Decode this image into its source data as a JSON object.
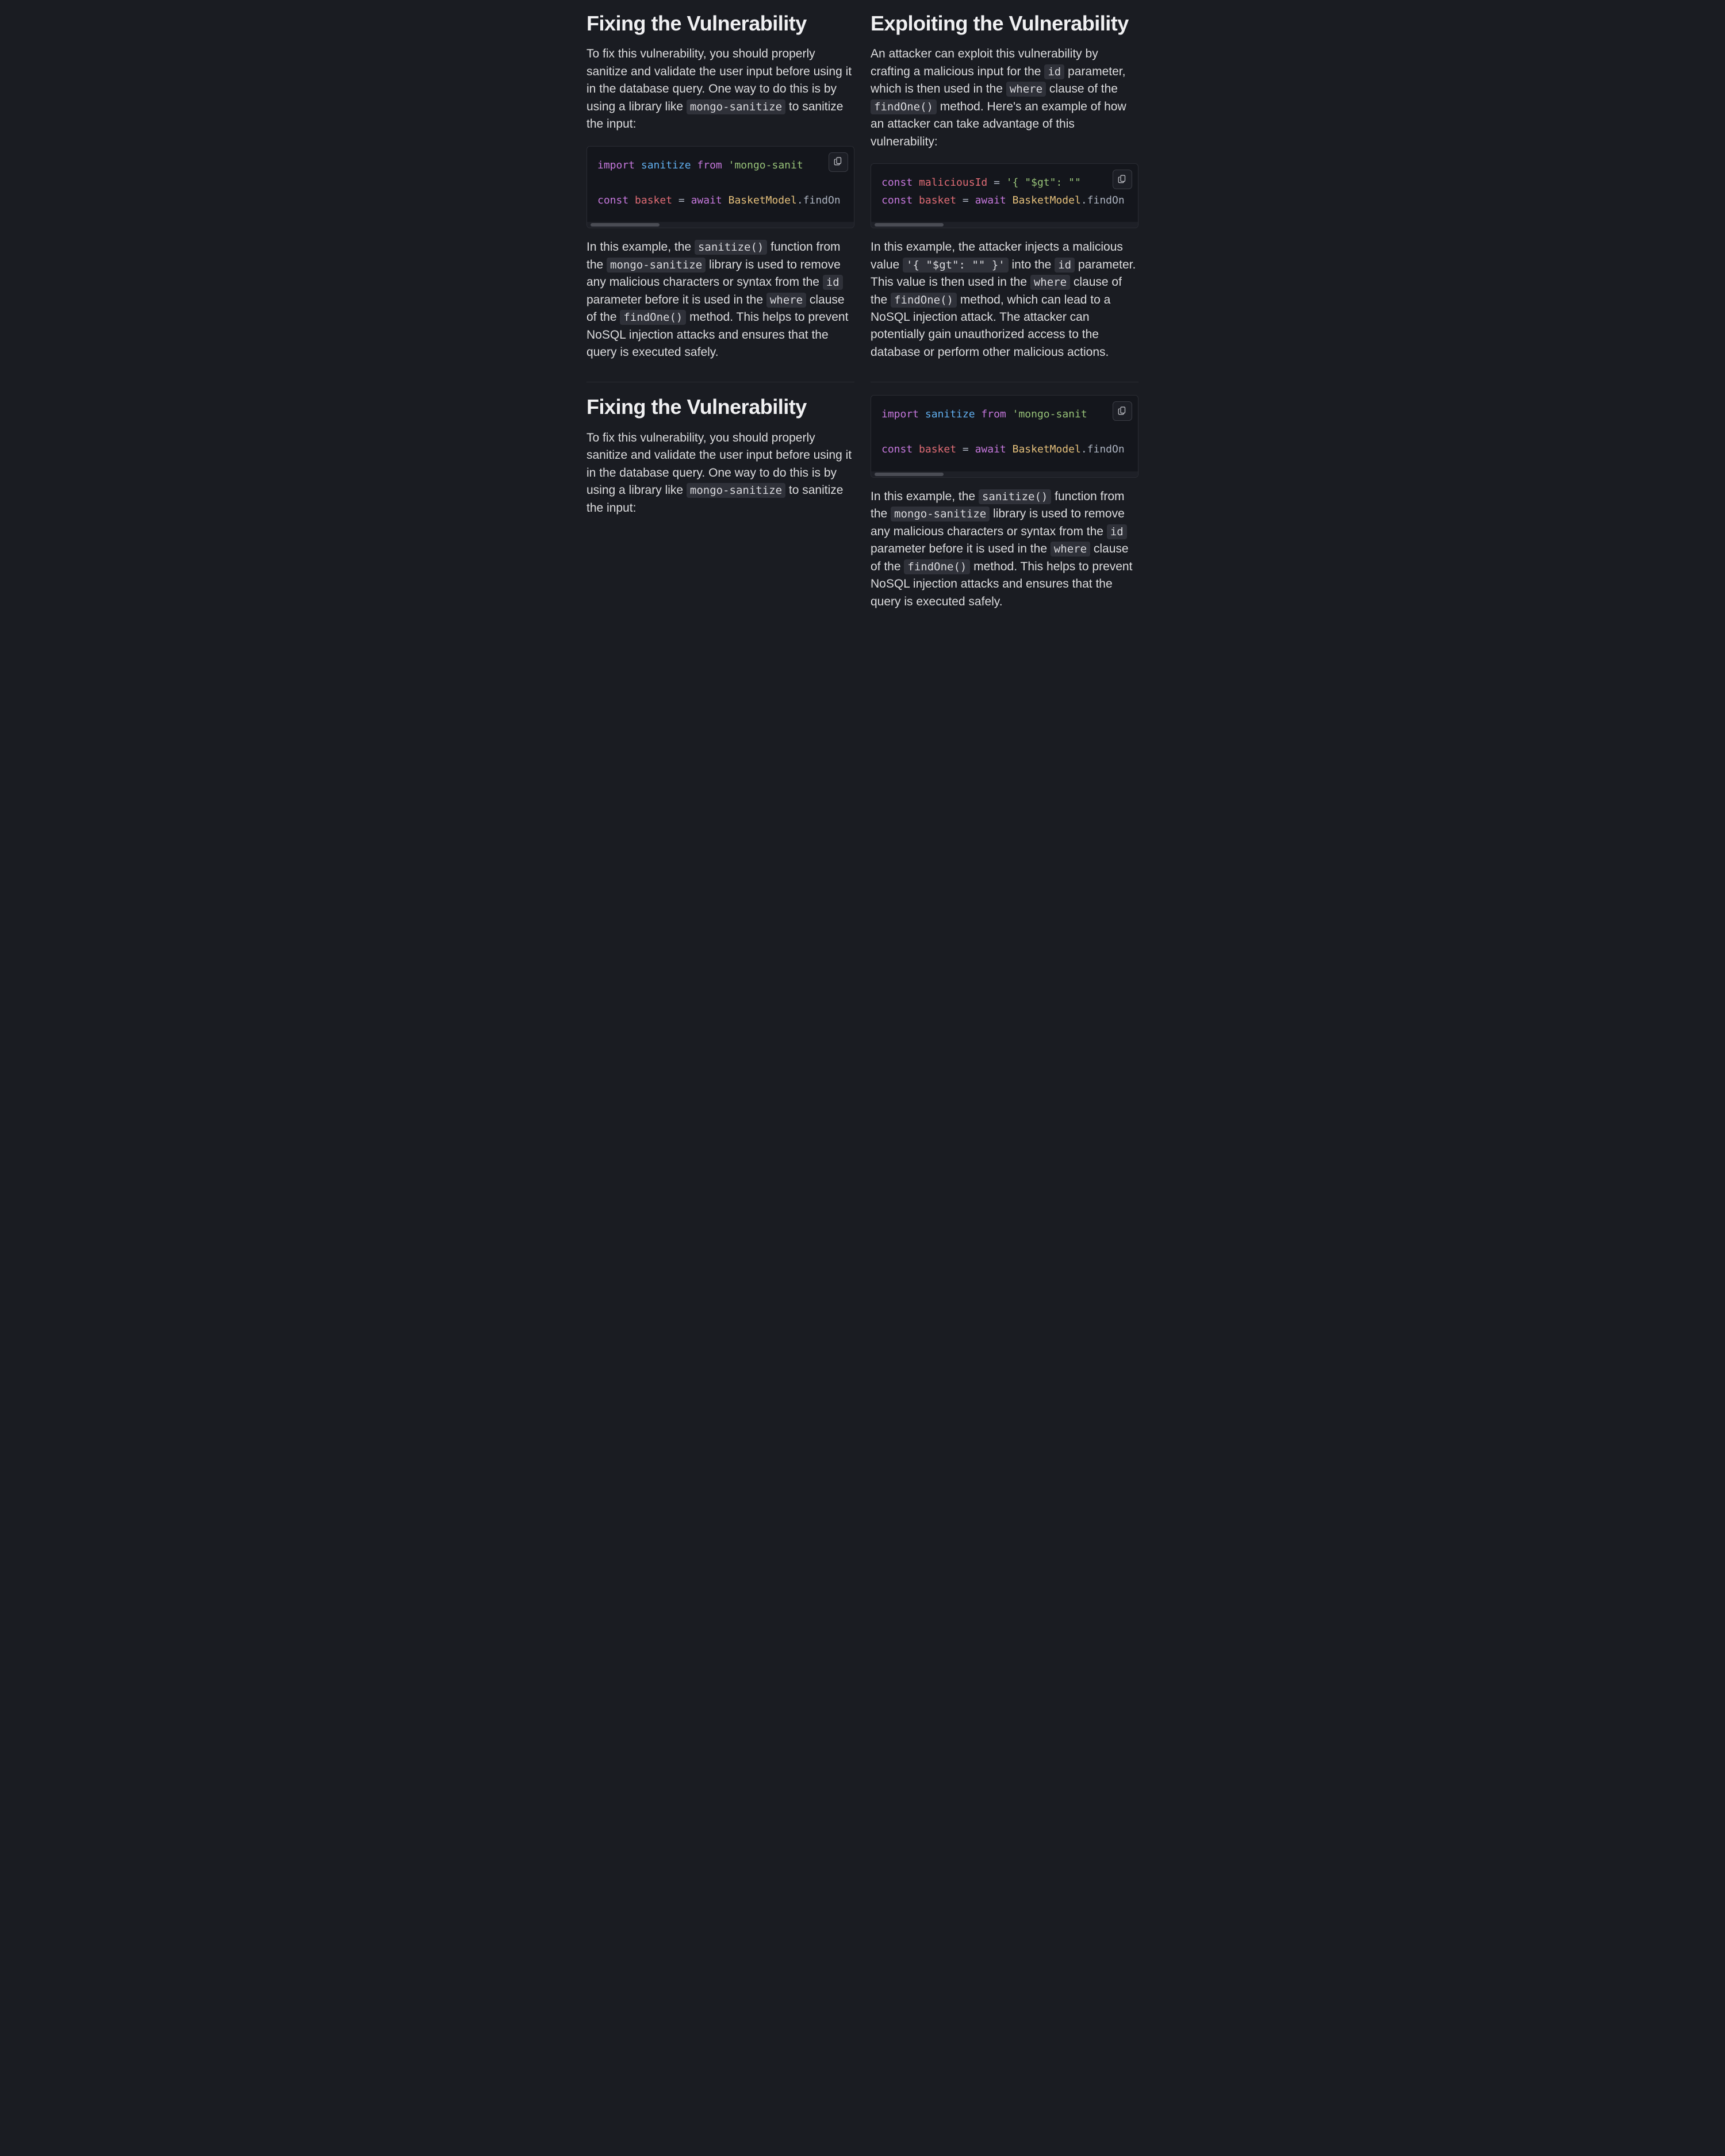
{
  "left": {
    "block1": {
      "heading": "Fixing the Vulnerability",
      "para1_a": "To fix this vulnerability, you should properly sanitize and validate the user input before using it in the database query. One way to do this is by using a library like ",
      "para1_code": "mongo-sanitize",
      "para1_b": " to sanitize the input:",
      "code": {
        "kw_import": "import",
        "fn_sanitize": "sanitize",
        "kw_from": "from",
        "str_pkg_open": "'mongo-sanit",
        "kw_const": "const",
        "id_basket": "basket",
        "eq": " = ",
        "kw_await": "await",
        "type_model": "BasketModel",
        "dot_findone": ".findOn"
      },
      "para2_a": "In this example, the ",
      "para2_c1": "sanitize()",
      "para2_b": " function from the ",
      "para2_c2": "mongo-sanitize",
      "para2_c": " library is used to remove any malicious characters or syntax from the ",
      "para2_c3": "id",
      "para2_d": " parameter before it is used in the ",
      "para2_c4": "where",
      "para2_e": " clause of the ",
      "para2_c5": "findOne()",
      "para2_f": " method. This helps to prevent NoSQL injection attacks and ensures that the query is executed safely."
    },
    "block2": {
      "heading": "Fixing the Vulnerability",
      "para1_a": "To fix this vulnerability, you should properly sanitize and validate the user input before using it in the database query. One way to do this is by using a library like ",
      "para1_code": "mongo-sanitize",
      "para1_b": " to sanitize the input:"
    }
  },
  "right": {
    "block1": {
      "heading": "Exploiting the Vulnerability",
      "para1_a": "An attacker can exploit this vulnerability by crafting a malicious input for the ",
      "para1_c1": "id",
      "para1_b": " parameter, which is then used in the ",
      "para1_c2": "where",
      "para1_c": " clause of the ",
      "para1_c3": "findOne()",
      "para1_d": " method. Here's an example of how an attacker can take advantage of this vulnerability:",
      "code": {
        "kw_const1": "const",
        "id_mal": "maliciousId",
        "eq": " = ",
        "str_mal": "'{ \"$gt\": \"\"",
        "kw_const2": "const",
        "id_basket": "basket",
        "kw_await": "await",
        "type_model": "BasketModel",
        "dot_findone": ".findOn"
      },
      "para2_a": "In this example, the attacker injects a malicious value ",
      "para2_c1": "'{ \"$gt\": \"\" }'",
      "para2_b": " into the ",
      "para2_c2": "id",
      "para2_c": " parameter. This value is then used in the ",
      "para2_c3": "where",
      "para2_d": " clause of the ",
      "para2_c4": "findOne()",
      "para2_e": " method, which can lead to a NoSQL injection attack. The attacker can potentially gain unauthorized access to the database or perform other malicious actions."
    },
    "block2": {
      "code": {
        "kw_import": "import",
        "fn_sanitize": "sanitize",
        "kw_from": "from",
        "str_pkg_open": "'mongo-sanit",
        "kw_const": "const",
        "id_basket": "basket",
        "eq": " = ",
        "kw_await": "await",
        "type_model": "BasketModel",
        "dot_findone": ".findOn"
      },
      "para_a": "In this example, the ",
      "para_c1": "sanitize()",
      "para_b": " function from the ",
      "para_c2": "mongo-sanitize",
      "para_c": " library is used to remove any malicious characters or syntax from the ",
      "para_c3": "id",
      "para_d": " parameter before it is used in the ",
      "para_c4": "where",
      "para_e": " clause of the ",
      "para_c5": "findOne()",
      "para_f": " method. This helps to prevent NoSQL injection attacks and ensures that the query is executed safely."
    }
  }
}
